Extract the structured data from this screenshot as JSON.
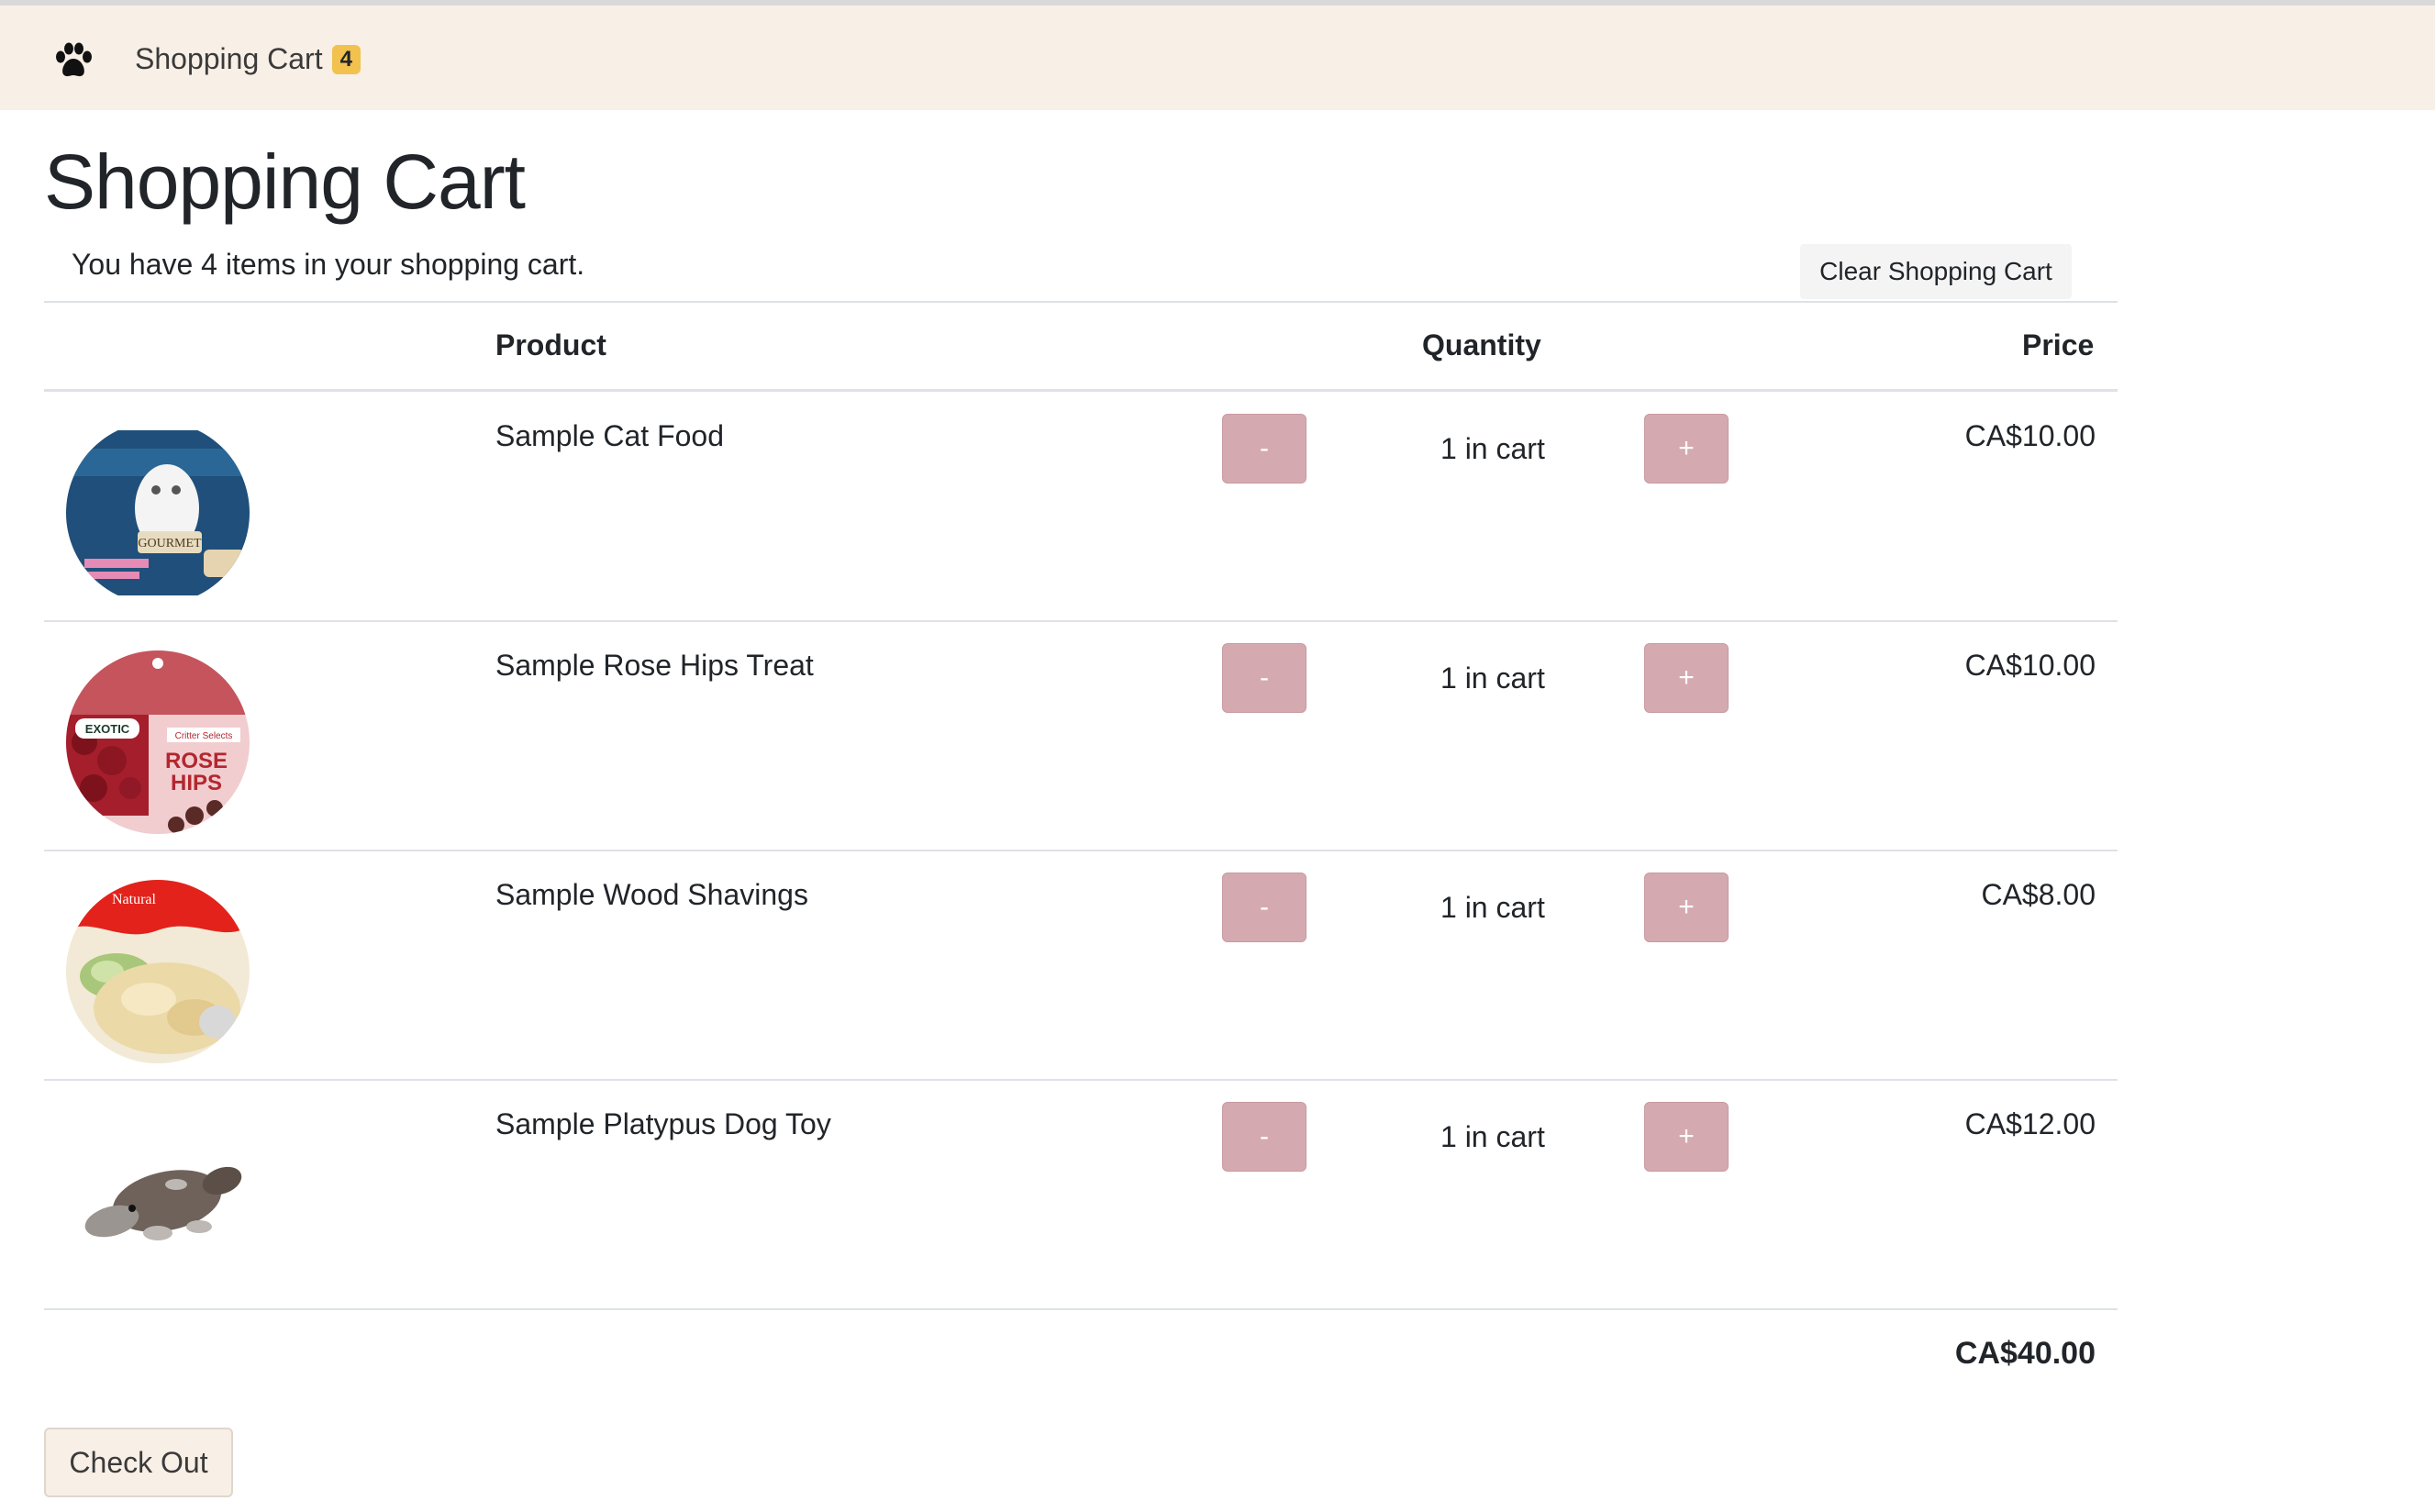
{
  "navbar": {
    "title": "Shopping Cart",
    "badge_count": "4"
  },
  "page": {
    "title": "Shopping Cart",
    "summary": "You have 4 items in your shopping cart.",
    "clear_label": "Clear Shopping Cart"
  },
  "table": {
    "headers": {
      "product": "Product",
      "quantity": "Quantity",
      "price": "Price"
    },
    "rows": [
      {
        "name": "Sample Cat Food",
        "quantity": "1 in cart",
        "price": "CA$10.00",
        "minus": "-",
        "plus": "+"
      },
      {
        "name": "Sample Rose Hips Treat",
        "quantity": "1 in cart",
        "price": "CA$10.00",
        "minus": "-",
        "plus": "+"
      },
      {
        "name": "Sample Wood Shavings",
        "quantity": "1 in cart",
        "price": "CA$8.00",
        "minus": "-",
        "plus": "+"
      },
      {
        "name": "Sample Platypus Dog Toy",
        "quantity": "1 in cart",
        "price": "CA$12.00",
        "minus": "-",
        "plus": "+"
      }
    ],
    "total": "CA$40.00"
  },
  "checkout_label": "Check Out",
  "colors": {
    "navbar_bg": "#f8efe6",
    "badge": "#f2c14e",
    "qty_button": "#d4aab0"
  },
  "icons": {
    "brand": "paw-icon"
  }
}
